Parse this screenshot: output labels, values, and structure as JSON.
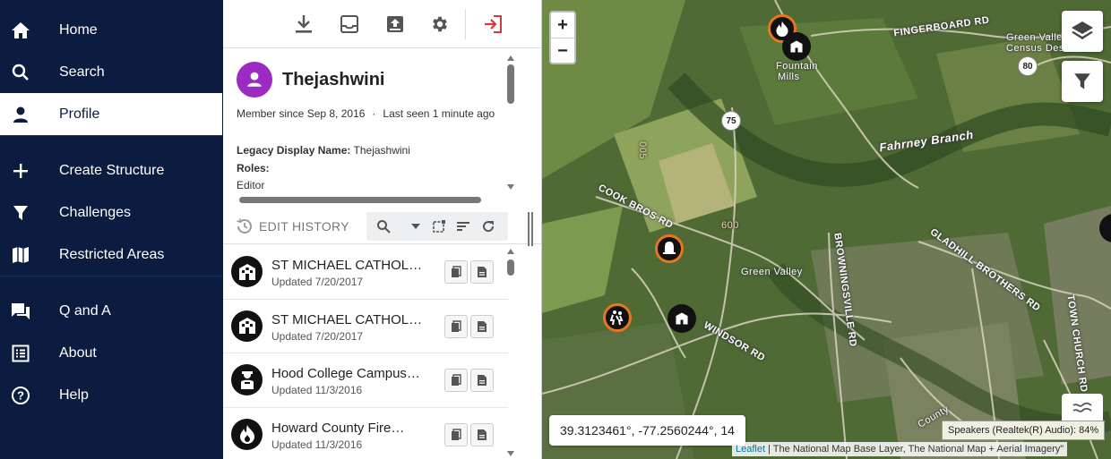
{
  "nav": {
    "home": "Home",
    "search": "Search",
    "profile": "Profile",
    "create_structure": "Create Structure",
    "challenges": "Challenges",
    "restricted_areas": "Restricted Areas",
    "q_and_a": "Q and A",
    "about": "About",
    "help": "Help"
  },
  "profile": {
    "username": "Thejashwini",
    "member_since": "Member since Sep 8, 2016",
    "separator": "·",
    "last_seen": "Last seen 1 minute ago",
    "legacy_label": "Legacy Display Name:",
    "legacy_value": "Thejashwini",
    "roles_label": "Roles:",
    "roles_value": "Editor"
  },
  "edit_history": {
    "title": "EDIT HISTORY",
    "items": [
      {
        "name": "ST MICHAEL CATHOL…",
        "updated": "Updated 7/20/2017",
        "icon": "school-icon"
      },
      {
        "name": "ST MICHAEL CATHOL…",
        "updated": "Updated 7/20/2017",
        "icon": "school-icon"
      },
      {
        "name": "Hood College Campus…",
        "updated": "Updated 11/3/2016",
        "icon": "police-icon"
      },
      {
        "name": "Howard County Fire…",
        "updated": "Updated 11/3/2016",
        "icon": "fire-icon"
      }
    ]
  },
  "map": {
    "labels": {
      "fingerboard_rd": "FINGERBOARD RD",
      "green_valley_cdp": "Green Valley",
      "census_des": "Census Des",
      "fountain_mills_1": "Fountain",
      "fountain_mills_2": "Mills",
      "fahrney_branch": "Fahrney Branch",
      "cook_bros_rd": "COOK BROS RD",
      "green_valley": "Green Valley",
      "gladhill_brothers_rd": "GLADHILL BROTHERS RD",
      "browningsville_rd": "BROWNINGSVILLE RD",
      "windsor_rd": "WINDSOR RD",
      "route_75": "75",
      "route_80": "80",
      "road_600": "600",
      "road_005": "005",
      "county": "County",
      "town_church_rd": "TOWN CHURCH RD"
    },
    "coords": "39.3123461°, -77.2560244°, 14",
    "attribution_link": "Leaflet",
    "attribution_text": "| The National Map Base Layer, The National Map + Aerial Imagery\"",
    "tooltip": "Speakers (Realtek(R) Audio): 84%",
    "zoom_in": "+",
    "zoom_out": "−"
  }
}
